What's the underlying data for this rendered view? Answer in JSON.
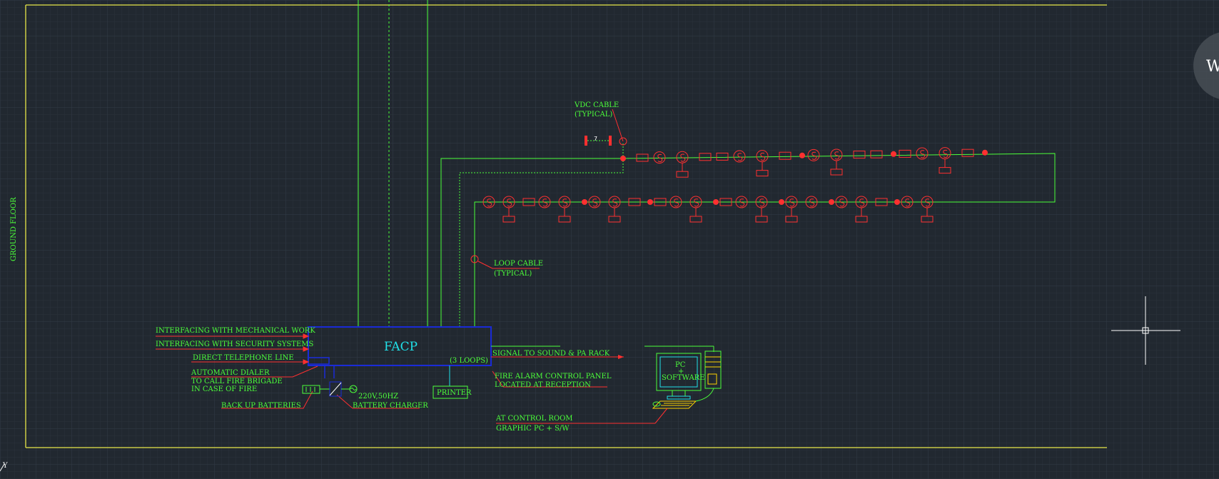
{
  "drawing": {
    "floor_label": "GROUND FLOOR",
    "panel_label": "FACP",
    "loops_label": "(3 LOOPS)",
    "printer_label": "PRINTER",
    "pc_label_line1": "PC",
    "pc_label_line2": "+",
    "pc_label_line3": "SOFTWARE",
    "vdc_cable_line1": "VDC CABLE",
    "vdc_cable_line2": "(TYPICAL)",
    "loop_cable_line1": "LOOP CABLE",
    "loop_cable_line2": "(TYPICAL)",
    "interfacing_mechanical": "INTERFACING WITH MECHANICAL WORK",
    "interfacing_security": "INTERFACING WITH SECURITY SYSTEMS",
    "direct_telephone": "DIRECT TELEPHONE LINE",
    "dialer_line1": "AUTOMATIC DIALER",
    "dialer_line2": "TO CALL FIRE BRIGADE",
    "dialer_line3": "IN CASE OF FIRE",
    "backup_batteries": "BACK UP BATTERIES",
    "power_supply": "220V,50HZ",
    "battery_charger": "BATTERY CHARGER",
    "signal_sound": "SIGNAL TO SOUND & PA RACK",
    "fire_alarm_line1": "FIRE ALARM CONTROL PANEL",
    "fire_alarm_line2": "LOCATED AT RECEPTION",
    "control_room_line1": "AT CONTROL ROOM",
    "control_room_line2": "GRAPHIC PC + S/W",
    "zone_number": "7",
    "axis_label": "Y",
    "watermark_letter": "W"
  },
  "colors": {
    "background": "#212830",
    "frame": "#e8e84a",
    "wire": "#4cff3a",
    "device": "#ff3030",
    "panel": "#1a2bd8",
    "panel_text": "#21e0e8"
  }
}
